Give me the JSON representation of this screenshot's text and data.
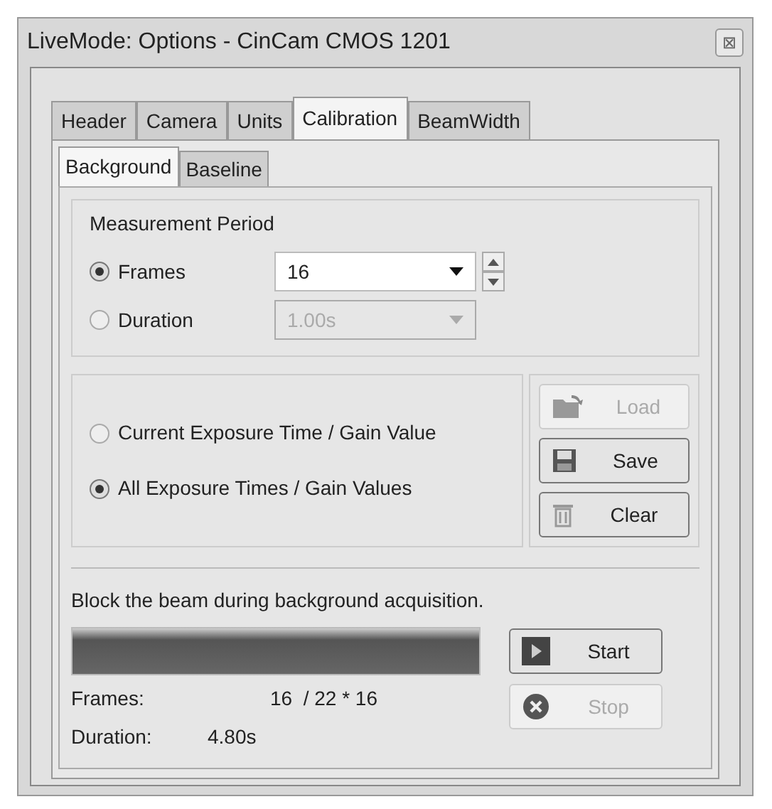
{
  "window": {
    "title": "LiveMode: Options - CinCam CMOS 1201",
    "close": "⊠"
  },
  "tabs": [
    {
      "label": "Header",
      "selected": false
    },
    {
      "label": "Camera",
      "selected": false
    },
    {
      "label": "Units",
      "selected": false
    },
    {
      "label": "Calibration",
      "selected": true
    },
    {
      "label": "BeamWidth",
      "selected": false
    }
  ],
  "subtabs": [
    {
      "label": "Background",
      "selected": true
    },
    {
      "label": "Baseline",
      "selected": false
    }
  ],
  "measurement_period": {
    "title": "Measurement Period",
    "options": [
      {
        "label": "Frames",
        "selected": true,
        "value": "16",
        "disabled": false,
        "spinner": true
      },
      {
        "label": "Duration",
        "selected": false,
        "value": "1.00s",
        "disabled": true,
        "spinner": false
      }
    ]
  },
  "exposure": {
    "options": [
      {
        "label": "Current Exposure Time / Gain Value",
        "selected": false
      },
      {
        "label": "All Exposure Times / Gain Values",
        "selected": true
      }
    ],
    "buttons": [
      {
        "kind": "load",
        "label": "Load",
        "disabled": true
      },
      {
        "kind": "save",
        "label": "Save",
        "disabled": false
      },
      {
        "kind": "clear",
        "label": "Clear",
        "disabled": false
      }
    ]
  },
  "acquisition": {
    "hint": "Block the beam during background acquisition.",
    "progress": {
      "level": 1.0
    },
    "frames_label": "Frames:",
    "frames_value": "16  / 22 * 16",
    "duration_label": "Duration:",
    "duration_value": "4.80s",
    "buttons": [
      {
        "kind": "start",
        "label": "Start",
        "disabled": false
      },
      {
        "kind": "stop",
        "label": "Stop",
        "disabled": true
      }
    ]
  }
}
